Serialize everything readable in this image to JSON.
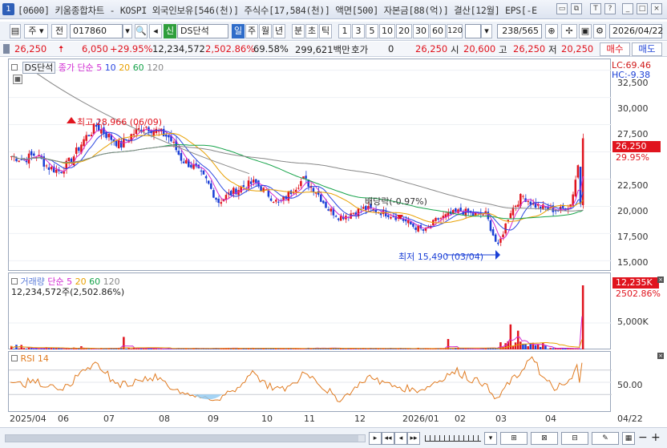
{
  "window": {
    "badge": "1",
    "title": "[0600] 키움종합차트 - KOSPI 외국인보유[546(천)] 주식수[17,584(천)] 액면[500] 자본금[88(억)] 결산[12월] EPS[-E",
    "buttons": [
      "T",
      "?",
      "_",
      "□",
      "×"
    ]
  },
  "toolbar": {
    "market": "주",
    "jeon": "전",
    "code": "017860",
    "indicator_badge": "신",
    "indicator_name": "DS단석",
    "periods": [
      "일",
      "주",
      "월",
      "년",
      "분",
      "초",
      "틱"
    ],
    "active_period": "일",
    "intervals": [
      "1",
      "3",
      "5",
      "10",
      "20",
      "30",
      "60",
      "120"
    ],
    "page_position": "238/565",
    "date": "2026/04/22"
  },
  "quote": {
    "price": "26,250",
    "change": "6,050",
    "change_pct": "+29.95%",
    "volume": "12,234,572",
    "volume_pct": "2,502.86%",
    "ratio": "69.58%",
    "amount": "299,621백만",
    "hoga_label": "호가",
    "hoga_value": "0",
    "hoga_price": "26,250",
    "open_label": "시",
    "open_value": "20,600",
    "high_label": "고",
    "high_value": "26,250",
    "low_label": "저",
    "low_value": "20,250",
    "buy": "매수",
    "sell": "매도"
  },
  "price_panel": {
    "legend_name": "DS단석",
    "ma_title": "종가 단순",
    "ma_periods": [
      "5",
      "10",
      "20",
      "60",
      "120"
    ],
    "lc": "LC:69.46",
    "hc": "HC:-9.38",
    "y_ticks": [
      "32,500",
      "30,000",
      "27,500",
      "25,000",
      "22,500",
      "20,000",
      "17,500",
      "15,000"
    ],
    "current_price_tag": "26,250",
    "current_pct_tag": "29.95%",
    "high_annotation": "최고 28,966 (06/09)",
    "low_annotation": "최저 15,490 (03/04)",
    "dividend_annotation": "배당락(-0.97%)"
  },
  "volume_panel": {
    "title": "거래량",
    "ma_title": "단순",
    "ma_periods": [
      "5",
      "20",
      "60",
      "120"
    ],
    "current": "12,234,572주(2,502.86%)",
    "tick": "5,000K",
    "tag_value": "12,235K",
    "tag_pct": "2502.86%"
  },
  "rsi_panel": {
    "title": "RSI 14",
    "tick": "50.00"
  },
  "x_axis": {
    "labels": [
      "2025/04",
      "06",
      "07",
      "08",
      "09",
      "10",
      "11",
      "12",
      "2026/01",
      "02",
      "03",
      "04"
    ],
    "right_label": "04/22"
  },
  "colors": {
    "up": "#e0141e",
    "down": "#1a3fd6",
    "ma5": "#d22ad2",
    "ma10": "#2b47e0",
    "ma20": "#e8a000",
    "ma60": "#16a34a",
    "ma120": "#888888",
    "rsi": "#e07a1f"
  },
  "chart_data": {
    "type": "candlestick",
    "ylim": [
      14000,
      33500
    ],
    "y_ticks": [
      15000,
      17500,
      20000,
      22500,
      25000,
      27500,
      30000,
      32500
    ],
    "x_categories": [
      "2025/04",
      "06",
      "07",
      "08",
      "09",
      "10",
      "11",
      "12",
      "2026/01",
      "02",
      "03",
      "04"
    ],
    "series_close": [
      {
        "m": "2025/04",
        "v": 24600
      },
      {
        "m": "2025/04",
        "v": 24300
      },
      {
        "m": "2025/04",
        "v": 24800
      },
      {
        "m": "2025/05",
        "v": 23600
      },
      {
        "m": "2025/05",
        "v": 23200
      },
      {
        "m": "2025/05",
        "v": 24400
      },
      {
        "m": "06",
        "v": 26200
      },
      {
        "m": "06",
        "v": 27400
      },
      {
        "m": "06",
        "v": 26400
      },
      {
        "m": "07",
        "v": 25600
      },
      {
        "m": "07",
        "v": 26700
      },
      {
        "m": "07",
        "v": 27400
      },
      {
        "m": "07",
        "v": 26900
      },
      {
        "m": "08",
        "v": 26300
      },
      {
        "m": "08",
        "v": 24300
      },
      {
        "m": "08",
        "v": 23600
      },
      {
        "m": "08",
        "v": 22400
      },
      {
        "m": "09",
        "v": 20400
      },
      {
        "m": "09",
        "v": 21200
      },
      {
        "m": "09",
        "v": 21800
      },
      {
        "m": "09",
        "v": 22200
      },
      {
        "m": "10",
        "v": 21200
      },
      {
        "m": "10",
        "v": 20200
      },
      {
        "m": "10",
        "v": 21400
      },
      {
        "m": "10",
        "v": 22500
      },
      {
        "m": "11",
        "v": 21500
      },
      {
        "m": "11",
        "v": 19800
      },
      {
        "m": "11",
        "v": 19000
      },
      {
        "m": "11",
        "v": 19400
      },
      {
        "m": "12",
        "v": 19800
      },
      {
        "m": "12",
        "v": 19600
      },
      {
        "m": "12",
        "v": 19300
      },
      {
        "m": "12",
        "v": 18900
      },
      {
        "m": "2026/01",
        "v": 18200
      },
      {
        "m": "2026/01",
        "v": 17700
      },
      {
        "m": "2026/01",
        "v": 18800
      },
      {
        "m": "2026/01",
        "v": 19200
      },
      {
        "m": "02",
        "v": 19600
      },
      {
        "m": "02",
        "v": 19200
      },
      {
        "m": "02",
        "v": 19300
      },
      {
        "m": "03",
        "v": 16200
      },
      {
        "m": "03",
        "v": 19500
      },
      {
        "m": "03",
        "v": 21000
      },
      {
        "m": "03",
        "v": 20100
      },
      {
        "m": "04",
        "v": 19800
      },
      {
        "m": "04",
        "v": 19600
      },
      {
        "m": "04",
        "v": 20200
      },
      {
        "m": "04",
        "v": 26250
      }
    ],
    "high": {
      "value": 28966,
      "date": "06/09"
    },
    "low": {
      "value": 15490,
      "date": "03/04"
    },
    "last": {
      "value": 26250,
      "change_pct": 29.95
    },
    "volume_last": 12234572,
    "rsi_period": 14
  }
}
